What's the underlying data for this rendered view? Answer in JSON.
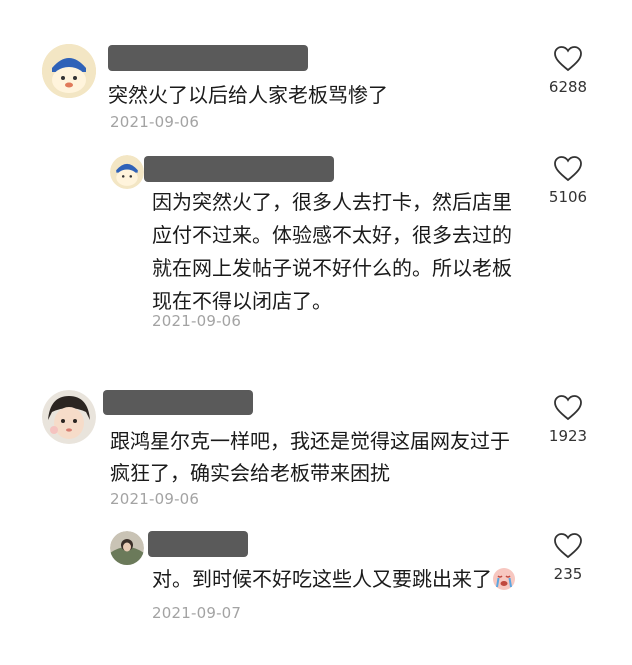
{
  "comments": [
    {
      "text": "突然火了以后给人家老板骂惨了",
      "time": "2021-09-06",
      "likes": "6288"
    },
    {
      "text": "因为突然火了，很多人去打卡，然后店里应付不过来。体验感不太好，很多去过的就在网上发帖子说不好什么的。所以老板现在不得以闭店了。",
      "time": "2021-09-06",
      "likes": "5106"
    },
    {
      "text": "跟鸿星尔克一样吧，我还是觉得这届网友过于疯狂了，确实会给老板带来困扰",
      "time": "2021-09-06",
      "likes": "1923"
    },
    {
      "text": "对。到时候不好吃这些人又要跳出来了",
      "time": "2021-09-07",
      "likes": "235"
    }
  ],
  "icons": {
    "like": "heart-outline-icon",
    "reply_emoji": "crying-face-emoji"
  }
}
